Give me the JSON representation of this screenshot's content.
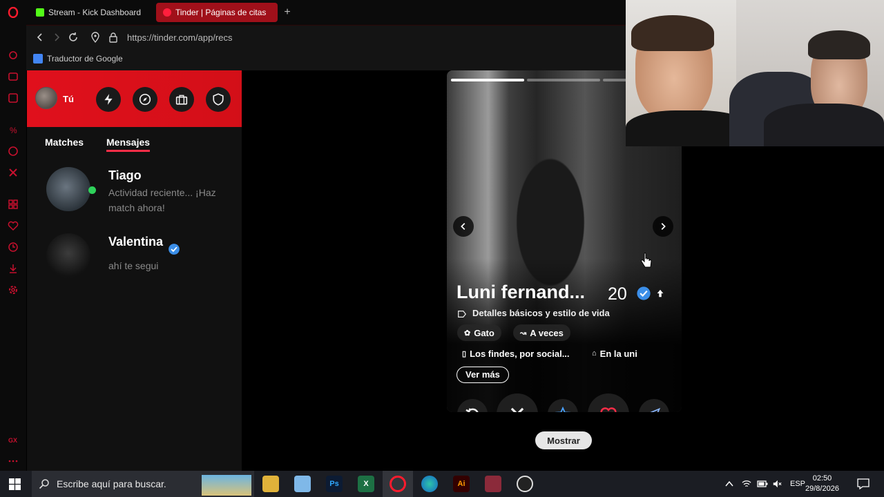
{
  "browser": {
    "tabs": [
      {
        "label": "Stream - Kick Dashboard",
        "favicon": "kick-icon",
        "color": "#53fc18"
      },
      {
        "label": "Tinder | Páginas de citas",
        "favicon": "tinder-icon",
        "color": "#ff1f3d"
      }
    ],
    "url": "https://tinder.com/app/recs",
    "bookmark": "Traductor de Google"
  },
  "tinder": {
    "accent": "#e0101c",
    "you_label": "Tú",
    "tabs": {
      "matches": "Matches",
      "messages": "Mensajes"
    },
    "conversations": [
      {
        "name": "Tiago",
        "message": "Actividad reciente... ¡Haz match ahora!",
        "online": true
      },
      {
        "name": "Valentina",
        "message": "ahí te segui",
        "verified": true
      }
    ],
    "profile": {
      "name": "Luni fernand...",
      "age": "20",
      "details_label": "Detalles básicos y estilo de vida",
      "chips": [
        "Gato",
        "A veces",
        "Los findes, por social...",
        "En la uni"
      ],
      "see_more": "Ver más"
    },
    "show_label": "Mostrar"
  },
  "taskbar": {
    "search_placeholder": "Escribe aquí para buscar.",
    "language": "ESP",
    "time": "02:50",
    "date": "29/8/2026"
  }
}
